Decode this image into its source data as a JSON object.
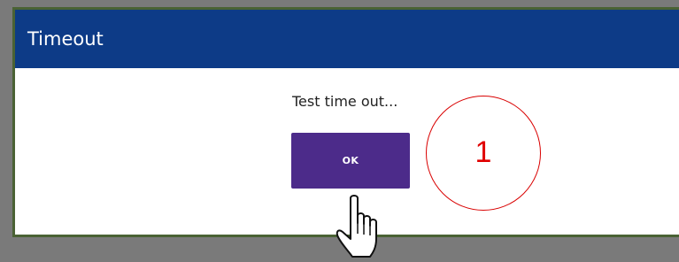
{
  "dialog": {
    "title": "Timeout",
    "message": "Test time out...",
    "ok_label": "OK"
  },
  "annotation": {
    "step_number": "1",
    "color": "#e00000"
  },
  "colors": {
    "header": "#0d3b87",
    "button": "#4c2b8a",
    "backdrop": "#7a7a7a",
    "dialog_border": "#4a6234"
  },
  "cursor": {
    "icon": "hand-pointer-icon"
  }
}
